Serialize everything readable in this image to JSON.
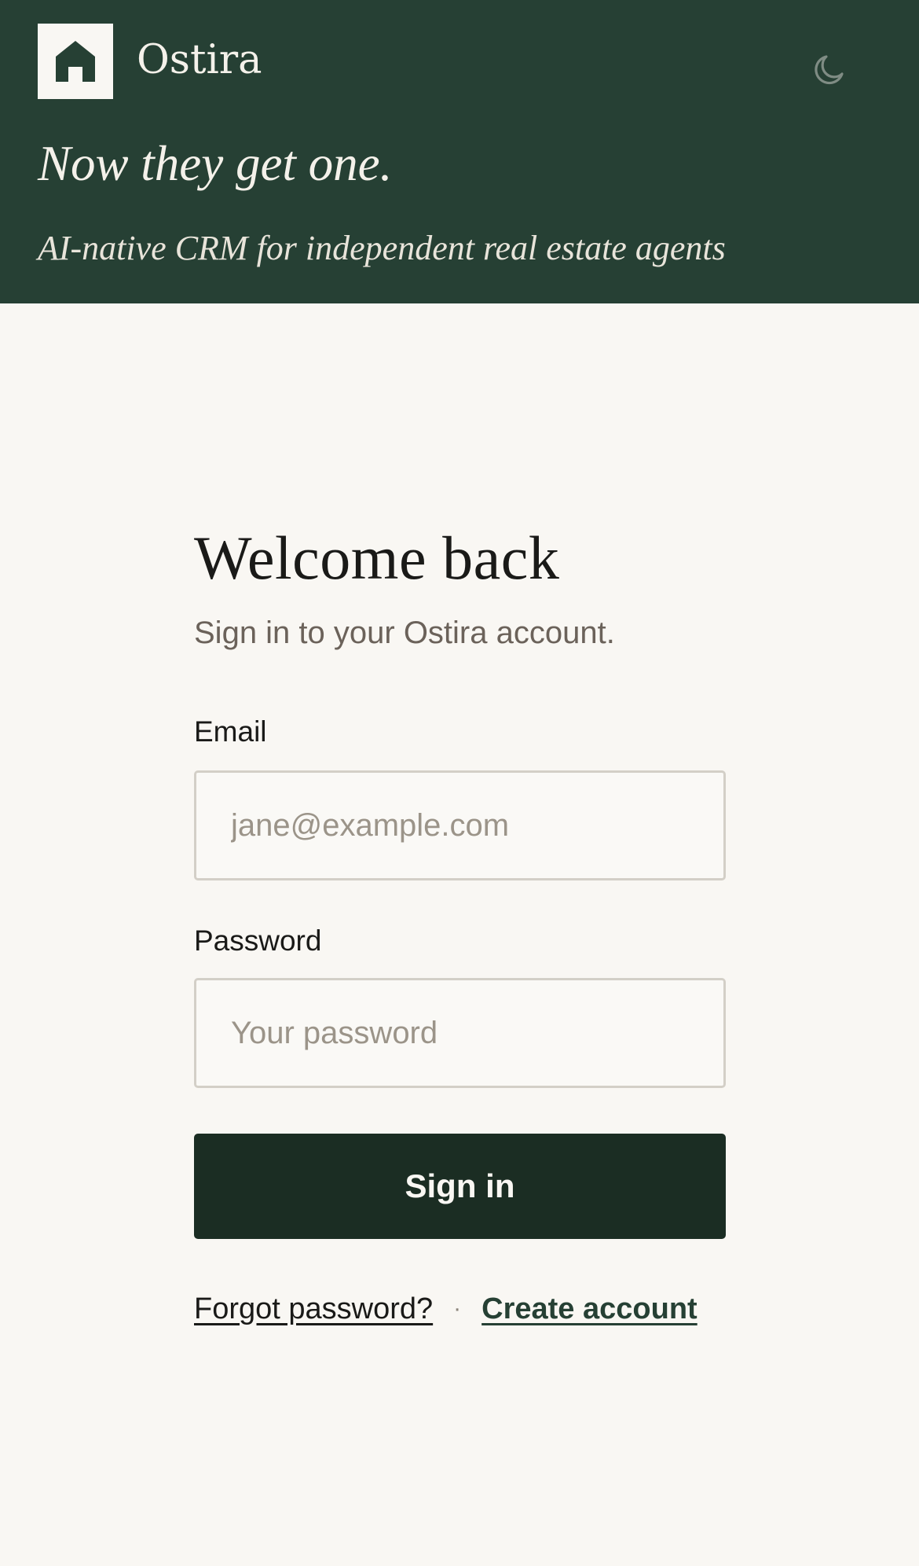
{
  "header": {
    "brand_name": "Ostira",
    "logo_icon": "house-icon",
    "tagline": "Now they get one.",
    "subtagline": "AI-native CRM for independent real estate agents",
    "theme_toggle_icon": "moon-icon"
  },
  "login": {
    "title": "Welcome back",
    "subtitle": "Sign in to your Ostira account.",
    "email_label": "Email",
    "email_placeholder": "jane@example.com",
    "email_value": "",
    "password_label": "Password",
    "password_placeholder": "Your password",
    "password_value": "",
    "submit_label": "Sign in",
    "forgot_label": "Forgot password?",
    "separator": "·",
    "create_label": "Create account"
  },
  "colors": {
    "header_bg": "#264034",
    "page_bg": "#f9f7f3",
    "button_bg": "#1b2d23",
    "link_accent": "#264034"
  }
}
